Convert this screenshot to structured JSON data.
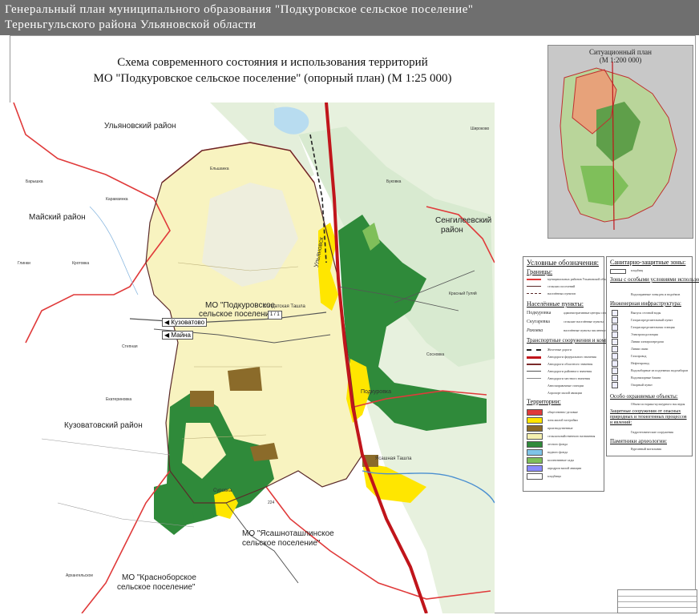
{
  "header": {
    "line1": "Генеральный план  муниципального образования \"Подкуровское сельское поселение\"",
    "line2": "Тереньгульского района Ульяновской области"
  },
  "title": {
    "line1": "Схема современного состояния и использования территорий",
    "line2": "МО \"Подкуровское сельское поселение\"  (опорный план) (М 1:25 000)"
  },
  "situation": {
    "title": "Ситуационный план",
    "scale": "(М 1:200 000)"
  },
  "map_labels": {
    "ulyanovsky_district": "Ульяновский район",
    "maysky_district": "Майский район",
    "sengileevsky_district_1": "Сенгилеевский",
    "sengileevsky_district_2": "район",
    "kuzovatovsky_district": "Кузоватовский район",
    "mo_podkurovskoe_1": "МО \"Подкуровское",
    "mo_podkurovskoe_2": "сельское поселение\"",
    "mo_yasashnotashlinskoe_1": "МО \"Ясашноташлинское",
    "mo_yasashnotashlinskoe_2": "сельское поселение\"",
    "mo_krasnoborskoe_1": "МО \"Красноборское",
    "mo_krasnoborskoe_2": "сельское поселение\"",
    "ulyanovsk": "Ульяновск",
    "podkurovka": "Подкуровка",
    "surovka": "Суровка",
    "soldatskaya_tashla": "Солдатская Ташла",
    "yasashnaya_tashla": "Ясашная Ташла",
    "kuzovatovo": "Кузоватово",
    "mayna": "Майна",
    "elshanka": "Ельшанка",
    "karamzinka": "Карамзинка",
    "baryshka": "Барышка",
    "krasny_gulyay": "Красный Гуляй",
    "sosnovka": "Сосновка",
    "ekaterinovka": "Екатериновка",
    "stepnaya": "Степная",
    "glinki": "Глинки",
    "krotovka": "Кротовка",
    "bukovka": "Буковка",
    "shirokovo": "Широково",
    "arkhangelskoe": "Архангельское"
  },
  "legend_main": {
    "title": "Условные обозначения:",
    "borders": "Границы:",
    "settlements": "Населённые пункты:",
    "transport": "Транспортные сооружения и коммуникации:",
    "territories": "Территории:",
    "border_items": [
      "муниципальных районов Ульяновской области",
      "сельских поселений",
      "населённых пунктов"
    ],
    "settlement_items": [
      {
        "name": "Подкуровка",
        "desc": "административные центры сельских поселений"
      },
      {
        "name": "Скугаревка",
        "desc": "сельские населённые пункты"
      },
      {
        "name": "Раковка",
        "desc": "населённые пункты численностью менее 100 человек"
      }
    ],
    "transport_items": [
      "Железные дороги",
      "Автодороги федерального значения",
      "Автодороги областного значения",
      "Автодороги районного значения",
      "Автодороги местного значения",
      "Автозаправочные станции",
      "Аэропорт малой авиации"
    ],
    "territory_items": [
      {
        "label": "общественно-деловые",
        "color": "#e03a3a"
      },
      {
        "label": "зона жилой застройки",
        "color": "#ffe600"
      },
      {
        "label": "производственные",
        "color": "#8b6b2a"
      },
      {
        "label": "сельскохозяйственного назначения",
        "color": "#f5f0b0"
      },
      {
        "label": "лесного фонда",
        "color": "#2f8a3a"
      },
      {
        "label": "водного фонда",
        "color": "#7fc4e8"
      },
      {
        "label": "коллективные сады",
        "color": "#7fbf5a"
      },
      {
        "label": "аэродром малой авиации",
        "color": "#8a8aff"
      },
      {
        "label": "кладбища",
        "color": "#ffffff"
      }
    ]
  },
  "legend_extra": {
    "sanitary": "Санитарно-защитные зоны:",
    "sanitary_item": "кладбищ",
    "special": "Зоны с особыми условиями использования:",
    "special_item": "Водоохранные зоны рек и водоёмов",
    "engineering": "Инженерная инфраструктура:",
    "engineering_items": [
      "Выпуск сточной воды",
      "Газораспределительный пункт",
      "Газораспределительная станция",
      "Электроподстанция",
      "Линии электропередачи",
      "Линии связи",
      "Газопровод",
      "Нефтепровод",
      "Водозаборные из подземных водозаборов",
      "Водонапорные башни",
      "Опорный пункт"
    ],
    "protected": "Особо охраняемые объекты:",
    "protected_item": "Объект историко-культурного наследия",
    "protective": "Защитные сооружения от опасных природных и техногенных процессов и явлений:",
    "protective_item": "Гидротехнические сооружения",
    "archaeology": "Памятники археологии:",
    "archaeology_item": "Курганный могильник"
  },
  "road_tags": {
    "a": "1 / 1",
    "b": "224"
  }
}
